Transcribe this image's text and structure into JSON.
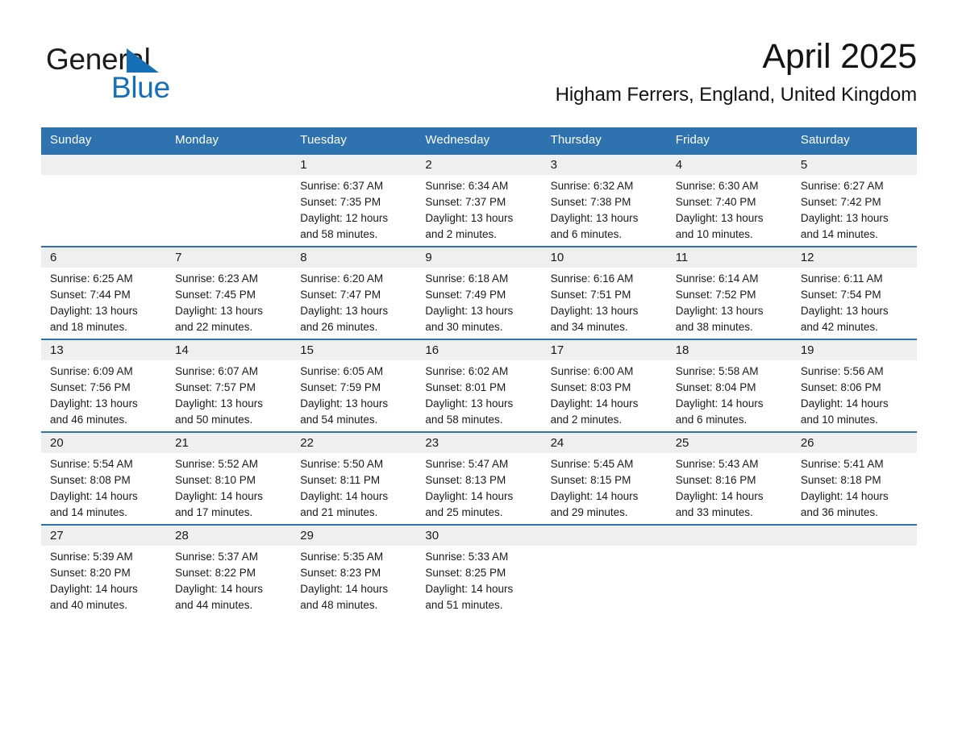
{
  "brand": {
    "name_top": "General",
    "name_bottom": "Blue",
    "triangle_color": "#1570b8"
  },
  "header": {
    "month_title": "April 2025",
    "location": "Higham Ferrers, England, United Kingdom"
  },
  "theme": {
    "header_bar": "#2f72b0",
    "row_divider": "#2f72b0",
    "daynum_band": "#efefef",
    "text": "#1a1a1a",
    "page_bg": "#ffffff"
  },
  "calendar": {
    "weekday_headers": [
      "Sunday",
      "Monday",
      "Tuesday",
      "Wednesday",
      "Thursday",
      "Friday",
      "Saturday"
    ],
    "weeks": [
      [
        {
          "day": "",
          "empty": true,
          "sunrise": "",
          "sunset": "",
          "daylight_line1": "",
          "daylight_line2": ""
        },
        {
          "day": "",
          "empty": true,
          "sunrise": "",
          "sunset": "",
          "daylight_line1": "",
          "daylight_line2": ""
        },
        {
          "day": "1",
          "empty": false,
          "sunrise": "Sunrise: 6:37 AM",
          "sunset": "Sunset: 7:35 PM",
          "daylight_line1": "Daylight: 12 hours",
          "daylight_line2": "and 58 minutes."
        },
        {
          "day": "2",
          "empty": false,
          "sunrise": "Sunrise: 6:34 AM",
          "sunset": "Sunset: 7:37 PM",
          "daylight_line1": "Daylight: 13 hours",
          "daylight_line2": "and 2 minutes."
        },
        {
          "day": "3",
          "empty": false,
          "sunrise": "Sunrise: 6:32 AM",
          "sunset": "Sunset: 7:38 PM",
          "daylight_line1": "Daylight: 13 hours",
          "daylight_line2": "and 6 minutes."
        },
        {
          "day": "4",
          "empty": false,
          "sunrise": "Sunrise: 6:30 AM",
          "sunset": "Sunset: 7:40 PM",
          "daylight_line1": "Daylight: 13 hours",
          "daylight_line2": "and 10 minutes."
        },
        {
          "day": "5",
          "empty": false,
          "sunrise": "Sunrise: 6:27 AM",
          "sunset": "Sunset: 7:42 PM",
          "daylight_line1": "Daylight: 13 hours",
          "daylight_line2": "and 14 minutes."
        }
      ],
      [
        {
          "day": "6",
          "empty": false,
          "sunrise": "Sunrise: 6:25 AM",
          "sunset": "Sunset: 7:44 PM",
          "daylight_line1": "Daylight: 13 hours",
          "daylight_line2": "and 18 minutes."
        },
        {
          "day": "7",
          "empty": false,
          "sunrise": "Sunrise: 6:23 AM",
          "sunset": "Sunset: 7:45 PM",
          "daylight_line1": "Daylight: 13 hours",
          "daylight_line2": "and 22 minutes."
        },
        {
          "day": "8",
          "empty": false,
          "sunrise": "Sunrise: 6:20 AM",
          "sunset": "Sunset: 7:47 PM",
          "daylight_line1": "Daylight: 13 hours",
          "daylight_line2": "and 26 minutes."
        },
        {
          "day": "9",
          "empty": false,
          "sunrise": "Sunrise: 6:18 AM",
          "sunset": "Sunset: 7:49 PM",
          "daylight_line1": "Daylight: 13 hours",
          "daylight_line2": "and 30 minutes."
        },
        {
          "day": "10",
          "empty": false,
          "sunrise": "Sunrise: 6:16 AM",
          "sunset": "Sunset: 7:51 PM",
          "daylight_line1": "Daylight: 13 hours",
          "daylight_line2": "and 34 minutes."
        },
        {
          "day": "11",
          "empty": false,
          "sunrise": "Sunrise: 6:14 AM",
          "sunset": "Sunset: 7:52 PM",
          "daylight_line1": "Daylight: 13 hours",
          "daylight_line2": "and 38 minutes."
        },
        {
          "day": "12",
          "empty": false,
          "sunrise": "Sunrise: 6:11 AM",
          "sunset": "Sunset: 7:54 PM",
          "daylight_line1": "Daylight: 13 hours",
          "daylight_line2": "and 42 minutes."
        }
      ],
      [
        {
          "day": "13",
          "empty": false,
          "sunrise": "Sunrise: 6:09 AM",
          "sunset": "Sunset: 7:56 PM",
          "daylight_line1": "Daylight: 13 hours",
          "daylight_line2": "and 46 minutes."
        },
        {
          "day": "14",
          "empty": false,
          "sunrise": "Sunrise: 6:07 AM",
          "sunset": "Sunset: 7:57 PM",
          "daylight_line1": "Daylight: 13 hours",
          "daylight_line2": "and 50 minutes."
        },
        {
          "day": "15",
          "empty": false,
          "sunrise": "Sunrise: 6:05 AM",
          "sunset": "Sunset: 7:59 PM",
          "daylight_line1": "Daylight: 13 hours",
          "daylight_line2": "and 54 minutes."
        },
        {
          "day": "16",
          "empty": false,
          "sunrise": "Sunrise: 6:02 AM",
          "sunset": "Sunset: 8:01 PM",
          "daylight_line1": "Daylight: 13 hours",
          "daylight_line2": "and 58 minutes."
        },
        {
          "day": "17",
          "empty": false,
          "sunrise": "Sunrise: 6:00 AM",
          "sunset": "Sunset: 8:03 PM",
          "daylight_line1": "Daylight: 14 hours",
          "daylight_line2": "and 2 minutes."
        },
        {
          "day": "18",
          "empty": false,
          "sunrise": "Sunrise: 5:58 AM",
          "sunset": "Sunset: 8:04 PM",
          "daylight_line1": "Daylight: 14 hours",
          "daylight_line2": "and 6 minutes."
        },
        {
          "day": "19",
          "empty": false,
          "sunrise": "Sunrise: 5:56 AM",
          "sunset": "Sunset: 8:06 PM",
          "daylight_line1": "Daylight: 14 hours",
          "daylight_line2": "and 10 minutes."
        }
      ],
      [
        {
          "day": "20",
          "empty": false,
          "sunrise": "Sunrise: 5:54 AM",
          "sunset": "Sunset: 8:08 PM",
          "daylight_line1": "Daylight: 14 hours",
          "daylight_line2": "and 14 minutes."
        },
        {
          "day": "21",
          "empty": false,
          "sunrise": "Sunrise: 5:52 AM",
          "sunset": "Sunset: 8:10 PM",
          "daylight_line1": "Daylight: 14 hours",
          "daylight_line2": "and 17 minutes."
        },
        {
          "day": "22",
          "empty": false,
          "sunrise": "Sunrise: 5:50 AM",
          "sunset": "Sunset: 8:11 PM",
          "daylight_line1": "Daylight: 14 hours",
          "daylight_line2": "and 21 minutes."
        },
        {
          "day": "23",
          "empty": false,
          "sunrise": "Sunrise: 5:47 AM",
          "sunset": "Sunset: 8:13 PM",
          "daylight_line1": "Daylight: 14 hours",
          "daylight_line2": "and 25 minutes."
        },
        {
          "day": "24",
          "empty": false,
          "sunrise": "Sunrise: 5:45 AM",
          "sunset": "Sunset: 8:15 PM",
          "daylight_line1": "Daylight: 14 hours",
          "daylight_line2": "and 29 minutes."
        },
        {
          "day": "25",
          "empty": false,
          "sunrise": "Sunrise: 5:43 AM",
          "sunset": "Sunset: 8:16 PM",
          "daylight_line1": "Daylight: 14 hours",
          "daylight_line2": "and 33 minutes."
        },
        {
          "day": "26",
          "empty": false,
          "sunrise": "Sunrise: 5:41 AM",
          "sunset": "Sunset: 8:18 PM",
          "daylight_line1": "Daylight: 14 hours",
          "daylight_line2": "and 36 minutes."
        }
      ],
      [
        {
          "day": "27",
          "empty": false,
          "sunrise": "Sunrise: 5:39 AM",
          "sunset": "Sunset: 8:20 PM",
          "daylight_line1": "Daylight: 14 hours",
          "daylight_line2": "and 40 minutes."
        },
        {
          "day": "28",
          "empty": false,
          "sunrise": "Sunrise: 5:37 AM",
          "sunset": "Sunset: 8:22 PM",
          "daylight_line1": "Daylight: 14 hours",
          "daylight_line2": "and 44 minutes."
        },
        {
          "day": "29",
          "empty": false,
          "sunrise": "Sunrise: 5:35 AM",
          "sunset": "Sunset: 8:23 PM",
          "daylight_line1": "Daylight: 14 hours",
          "daylight_line2": "and 48 minutes."
        },
        {
          "day": "30",
          "empty": false,
          "sunrise": "Sunrise: 5:33 AM",
          "sunset": "Sunset: 8:25 PM",
          "daylight_line1": "Daylight: 14 hours",
          "daylight_line2": "and 51 minutes."
        },
        {
          "day": "",
          "empty": true,
          "sunrise": "",
          "sunset": "",
          "daylight_line1": "",
          "daylight_line2": ""
        },
        {
          "day": "",
          "empty": true,
          "sunrise": "",
          "sunset": "",
          "daylight_line1": "",
          "daylight_line2": ""
        },
        {
          "day": "",
          "empty": true,
          "sunrise": "",
          "sunset": "",
          "daylight_line1": "",
          "daylight_line2": ""
        }
      ]
    ]
  }
}
